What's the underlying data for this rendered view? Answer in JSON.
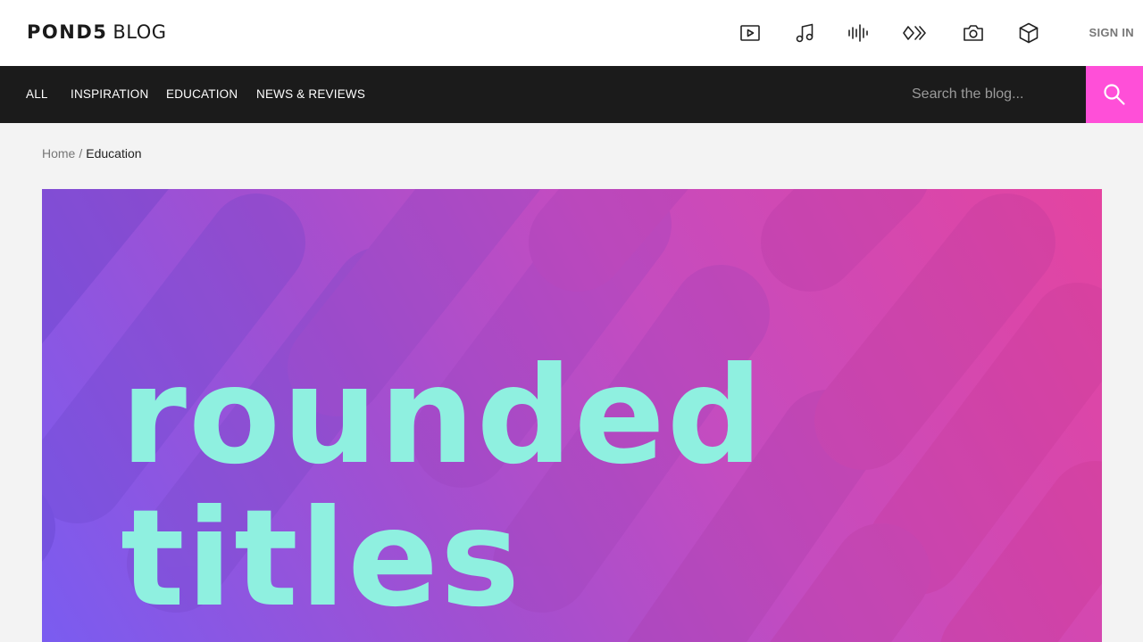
{
  "header": {
    "logo_brand": "POND5",
    "logo_sub": "BLOG",
    "signin_label": "SIGN IN",
    "category_icons": [
      {
        "name": "video-icon"
      },
      {
        "name": "music-icon"
      },
      {
        "name": "sound-effects-icon"
      },
      {
        "name": "after-effects-icon"
      },
      {
        "name": "photo-icon"
      },
      {
        "name": "3d-icon"
      }
    ]
  },
  "nav": {
    "items": [
      {
        "label": "ALL"
      },
      {
        "label": "INSPIRATION"
      },
      {
        "label": "EDUCATION"
      },
      {
        "label": "NEWS & REVIEWS"
      }
    ],
    "search_placeholder": "Search the blog...",
    "search_accent": "#ff4fd8"
  },
  "breadcrumb": {
    "home": "Home",
    "separator": "/",
    "current": "Education"
  },
  "hero": {
    "line1": "rounded",
    "line2": "titles",
    "text_color": "#8ff0e0",
    "gradient_from": "#7a5cf0",
    "gradient_to": "#e444a0"
  }
}
